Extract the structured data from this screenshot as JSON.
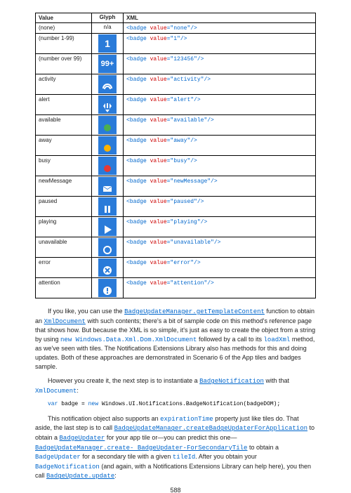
{
  "table": {
    "headers": [
      "Value",
      "Glyph",
      "XML"
    ],
    "rows": [
      {
        "value": "(none)",
        "glyph": "n/a",
        "glyph_type": "text",
        "xml": "<badge value=\"none\"/>"
      },
      {
        "value": "(number 1-99)",
        "glyph": "1",
        "glyph_type": "num",
        "xml": "<badge value=\"1\"/>"
      },
      {
        "value": "(number over 99)",
        "glyph": "99+",
        "glyph_type": "num99",
        "xml": "<badge value=\"123456\"/>"
      },
      {
        "value": "activity",
        "glyph": "activity",
        "glyph_type": "icon",
        "xml": "<badge value=\"activity\"/>"
      },
      {
        "value": "alert",
        "glyph": "alert",
        "glyph_type": "icon",
        "xml": "<badge value=\"alert\"/>"
      },
      {
        "value": "available",
        "glyph": "available",
        "glyph_type": "icon",
        "xml": "<badge value=\"available\"/>"
      },
      {
        "value": "away",
        "glyph": "away",
        "glyph_type": "icon",
        "xml": "<badge value=\"away\"/>"
      },
      {
        "value": "busy",
        "glyph": "busy",
        "glyph_type": "icon",
        "xml": "<badge value=\"busy\"/>"
      },
      {
        "value": "newMessage",
        "glyph": "newMessage",
        "glyph_type": "icon",
        "xml": "<badge value=\"newMessage\"/>"
      },
      {
        "value": "paused",
        "glyph": "paused",
        "glyph_type": "icon",
        "xml": "<badge value=\"paused\"/>"
      },
      {
        "value": "playing",
        "glyph": "playing",
        "glyph_type": "icon",
        "xml": "<badge value=\"playing\"/>"
      },
      {
        "value": "unavailable",
        "glyph": "unavailable",
        "glyph_type": "icon",
        "xml": "<badge value=\"unavailable\"/>"
      },
      {
        "value": "error",
        "glyph": "error",
        "glyph_type": "icon",
        "xml": "<badge value=\"error\"/>"
      },
      {
        "value": "attention",
        "glyph": "attention",
        "glyph_type": "icon",
        "xml": "<badge value=\"attention\"/>"
      }
    ]
  },
  "para1": {
    "t1": "If you like, you can use the ",
    "l1": "BadgeUpdateManager.getTemplateContent",
    "t2": " function to obtain an ",
    "l2": "XmlDocument",
    "t3": " with such contents; there's a bit of sample code on this method's reference page that shows how. But because the XML is so simple, it's just as easy to create the object from a string by using ",
    "c1": "new Windows.Data.Xml.Dom.XmlDocument",
    "t4": " followed by a call to its ",
    "c2": "loadXml",
    "t5": " method, as we've seen with tiles. The Notifications Extensions Library also has methods for this and doing updates. Both of these approaches are demonstrated in Scenario 6 of the App tiles and badges sample."
  },
  "para2": {
    "t1": "However you create it, the next step is to instantiate a ",
    "l1": "BadgeNotification",
    "t2": " with that ",
    "c1": "XmlDocument",
    "t3": ":"
  },
  "code1": {
    "kw1": "var",
    "rest": " badge = ",
    "kw2": "new",
    "rest2": " Windows.UI.Notifications.BadgeNotification(badgeDOM);"
  },
  "para3": {
    "t1": "This notification object also supports an ",
    "c1": "expirationTime",
    "t2": " property just like tiles do. That aside, the last step is to call ",
    "l1": "BadgeUpdateManager.createBadgeUpdaterForApplication",
    "t3": " to obtain a ",
    "l2": "BadgeUpdater",
    "t4": " for your app tile or—you can predict this one—",
    "l3": "BadgeUpdateManager.create- BadgeUpdater-ForSecondaryTile",
    "t5": " to obtain a ",
    "c2": "BadgeUpdater",
    "t6": " for a secondary tile with a given ",
    "c3": "tileId",
    "t7": ". After you obtain your ",
    "c4": "BadgeNotification",
    "t8": " (and again, with a Notifications Extensions Library can help here), you then call ",
    "l4": "BadgeUpdate.update",
    "t9": ":"
  },
  "pagenum": "588"
}
